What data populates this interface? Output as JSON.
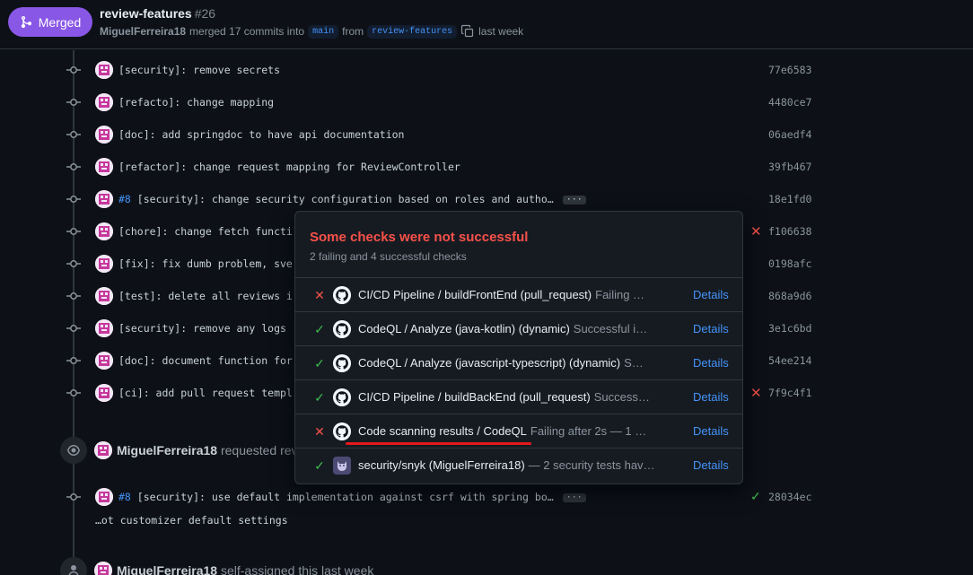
{
  "header": {
    "badge_label": "Merged",
    "title": "review-features",
    "number": "#26",
    "author": "MiguelFerreira18",
    "merged_text": "merged 17 commits into",
    "base_branch": "main",
    "from_text": "from",
    "head_branch": "review-features",
    "time": "last week"
  },
  "commits": [
    {
      "issue": "",
      "message": "[security]: remove secrets",
      "sha": "77e6583",
      "status": ""
    },
    {
      "issue": "",
      "message": "[refacto]: change mapping",
      "sha": "4480ce7",
      "status": ""
    },
    {
      "issue": "",
      "message": "[doc]: add springdoc to have api documentation",
      "sha": "06aedf4",
      "status": ""
    },
    {
      "issue": "",
      "message": "[refactor]: change request mapping for ReviewController",
      "sha": "39fb467",
      "status": ""
    },
    {
      "issue": "#8",
      "message": "[security]: change security configuration based on roles and autho…",
      "sha": "18e1fd0",
      "status": ""
    },
    {
      "issue": "",
      "message": "[chore]: change fetch functi",
      "sha": "f106638",
      "status": "fail"
    },
    {
      "issue": "",
      "message": "[fix]: fix dumb problem, sve",
      "sha": "0198afc",
      "status": ""
    },
    {
      "issue": "",
      "message": "[test]: delete all reviews i",
      "sha": "868a9d6",
      "status": ""
    },
    {
      "issue": "",
      "message": "[security]: remove any logs",
      "sha": "3e1c6bd",
      "status": ""
    },
    {
      "issue": "",
      "message": "[doc]: document function for",
      "sha": "54ee214",
      "status": ""
    },
    {
      "issue": "",
      "message": "[ci]: add pull request templ",
      "sha": "7f9c4f1",
      "status": "fail"
    }
  ],
  "review_event": {
    "author": "MiguelFerreira18",
    "text": "requested revi"
  },
  "last_commit": {
    "issue": "#8",
    "message": "[security]: use default implementation against csrf with spring bo…",
    "sha": "28034ec",
    "status": "pass",
    "continuation": "…ot customizer default settings"
  },
  "assign_event": {
    "author": "MiguelFerreira18",
    "text": "self-assigned this last week"
  },
  "popup": {
    "title": "Some checks were not successful",
    "subtitle": "2 failing and 4 successful checks",
    "checks": [
      {
        "status": "fail",
        "logo": "github-icon",
        "name": "CI/CD Pipeline / buildFrontEnd (pull_request)",
        "detail": "Failing …",
        "link": "Details"
      },
      {
        "status": "pass",
        "logo": "github-icon",
        "name": "CodeQL / Analyze (java-kotlin) (dynamic)",
        "detail": "Successful i…",
        "link": "Details"
      },
      {
        "status": "pass",
        "logo": "github-icon",
        "name": "CodeQL / Analyze (javascript-typescript) (dynamic)",
        "detail": "S…",
        "link": "Details"
      },
      {
        "status": "pass",
        "logo": "github-icon",
        "name": "CI/CD Pipeline / buildBackEnd (pull_request)",
        "detail": "Success…",
        "link": "Details"
      },
      {
        "status": "fail",
        "logo": "github-icon",
        "name": "Code scanning results / CodeQL",
        "detail": "Failing after 2s — 1 …",
        "link": "Details"
      },
      {
        "status": "pass",
        "logo": "snyk-icon",
        "name": "security/snyk (MiguelFerreira18)",
        "detail": "— 2 security tests hav…",
        "link": "Details"
      }
    ]
  },
  "colors": {
    "merged": "#8957e5",
    "fail": "#f85149",
    "pass": "#3fb950",
    "link": "#4493f8",
    "annotation": "#e5181b"
  }
}
